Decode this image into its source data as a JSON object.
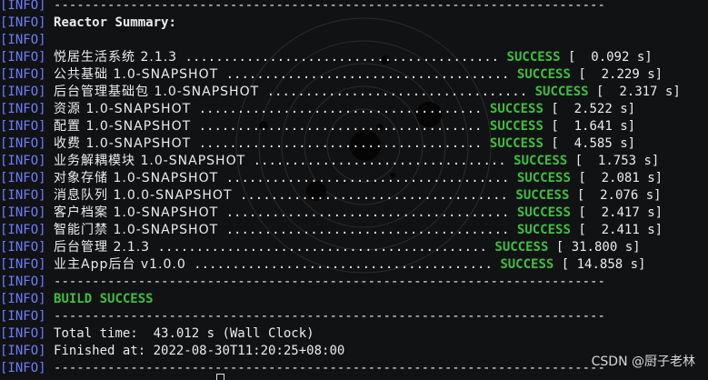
{
  "log_tag": "[INFO]",
  "separator": "------------------------------------------------------------------------",
  "summary_title": "Reactor Summary:",
  "modules": [
    {
      "name": "悦居生活系统 2.1.3",
      "dots": " ......................................... ",
      "status": "SUCCESS",
      "time": "[  0.092 s]"
    },
    {
      "name": "公共基础 1.0-SNAPSHOT",
      "dots": " ..................................... ",
      "status": "SUCCESS",
      "time": "[  2.229 s]"
    },
    {
      "name": "后台管理基础包 1.0-SNAPSHOT",
      "dots": " .................................. ",
      "status": "SUCCESS",
      "time": "[  2.317 s]"
    },
    {
      "name": "资源 1.0-SNAPSHOT",
      "dots": " ..................................... ",
      "status": "SUCCESS",
      "time": "[  2.522 s]"
    },
    {
      "name": "配置 1.0-SNAPSHOT",
      "dots": " ..................................... ",
      "status": "SUCCESS",
      "time": "[  1.641 s]"
    },
    {
      "name": "收费 1.0-SNAPSHOT",
      "dots": " ..................................... ",
      "status": "SUCCESS",
      "time": "[  4.585 s]"
    },
    {
      "name": "业务解耦模块 1.0-SNAPSHOT",
      "dots": " ................................. ",
      "status": "SUCCESS",
      "time": "[  1.753 s]"
    },
    {
      "name": "对象存储 1.0-SNAPSHOT",
      "dots": " ..................................... ",
      "status": "SUCCESS",
      "time": "[  2.081 s]"
    },
    {
      "name": "消息队列 1.0.0-SNAPSHOT",
      "dots": " ................................... ",
      "status": "SUCCESS",
      "time": "[  2.076 s]"
    },
    {
      "name": "客户档案 1.0-SNAPSHOT",
      "dots": " ..................................... ",
      "status": "SUCCESS",
      "time": "[  2.417 s]"
    },
    {
      "name": "智能门禁 1.0-SNAPSHOT",
      "dots": " ..................................... ",
      "status": "SUCCESS",
      "time": "[  2.411 s]"
    },
    {
      "name": "后台管理 2.1.3",
      "dots": " ........................................... ",
      "status": "SUCCESS",
      "time": "[ 31.800 s]"
    },
    {
      "name": "业主App后台 v1.0.0",
      "dots": " ....................................... ",
      "status": "SUCCESS",
      "time": "[ 14.858 s]"
    }
  ],
  "build_result": "BUILD SUCCESS",
  "total_time": "Total time:  43.012 s (Wall Clock)",
  "finished_at": "Finished at: 2022-08-30T11:20:25+08:00",
  "watermark": "CSDN @厨子老林"
}
